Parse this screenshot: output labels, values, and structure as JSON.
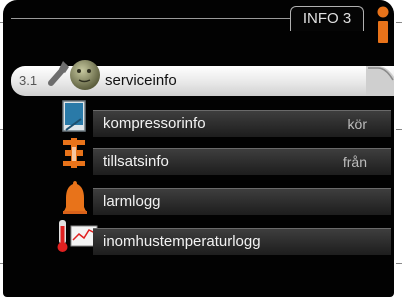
{
  "header": {
    "title": "INFO 3"
  },
  "selected": {
    "number": "3.1",
    "label": "serviceinfo"
  },
  "items": [
    {
      "label": "kompressorinfo",
      "value": "kör"
    },
    {
      "label": "tillsatsinfo",
      "value": "från"
    },
    {
      "label": "larmlogg",
      "value": ""
    },
    {
      "label": "inomhustemperaturlogg",
      "value": ""
    }
  ],
  "icons": {
    "top_right": "info-icon",
    "selected": "tools-icon",
    "item_0": "compressor-icon",
    "item_1": "heater-icon",
    "item_2": "alarm-bell-icon",
    "item_3": "thermometer-graph-icon"
  },
  "colors": {
    "screen": "#020202",
    "accent_orange": "#e8731a",
    "selected_bg": "#ececec"
  }
}
